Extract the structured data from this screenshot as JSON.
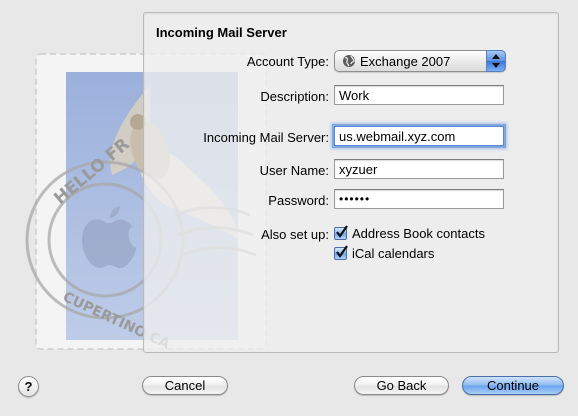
{
  "stamp": {
    "postmark_top": "HELLO FR",
    "postmark_bottom": "CUPERTINO CA"
  },
  "panel": {
    "title": "Incoming Mail Server",
    "account_type": {
      "label": "Account Type:",
      "value": "Exchange 2007"
    },
    "description": {
      "label": "Description:",
      "value": "Work"
    },
    "incoming_server": {
      "label": "Incoming Mail Server:",
      "value": "us.webmail.xyz.com"
    },
    "user_name": {
      "label": "User Name:",
      "value": "xyzuer"
    },
    "password": {
      "label": "Password:",
      "value": "••••••"
    },
    "also_setup": {
      "label": "Also set up:",
      "options": [
        {
          "label": "Address Book contacts",
          "checked": true
        },
        {
          "label": "iCal calendars",
          "checked": true
        }
      ]
    }
  },
  "buttons": {
    "help": "?",
    "cancel": "Cancel",
    "go_back": "Go Back",
    "continue": "Continue"
  },
  "icons": {
    "account_type": "globe-icon",
    "popup": "up-down-arrows-icon",
    "checkbox": "checkmark-icon"
  }
}
